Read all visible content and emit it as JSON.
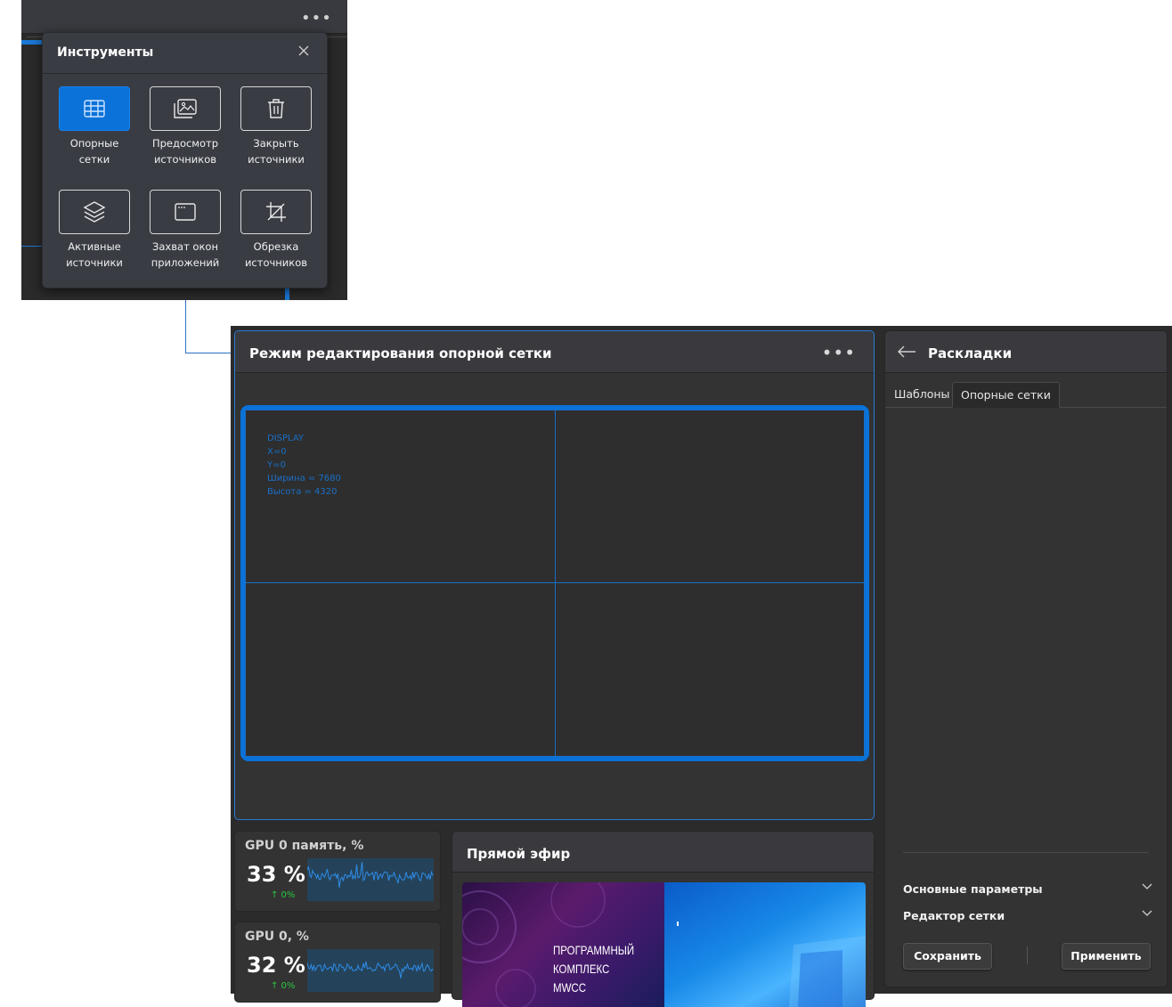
{
  "tools": {
    "title": "Инструменты",
    "items": [
      {
        "line1": "Опорные",
        "line2": "сетки",
        "icon": "grid-icon",
        "active": true
      },
      {
        "line1": "Предосмотр",
        "line2": "источников",
        "icon": "gallery-icon",
        "active": false
      },
      {
        "line1": "Закрыть",
        "line2": "источники",
        "icon": "trash-icon",
        "active": false
      },
      {
        "line1": "Активные",
        "line2": "источники",
        "icon": "layers-icon",
        "active": false
      },
      {
        "line1": "Захват окон",
        "line2": "приложений",
        "icon": "window-icon",
        "active": false
      },
      {
        "line1": "Обрезка",
        "line2": "источников",
        "icon": "crop-icon",
        "active": false
      }
    ]
  },
  "editor": {
    "title": "Режим редактирования опорной сетки",
    "display": {
      "line1": "DISPLAY",
      "line2": "X=0",
      "line3": "Y=0",
      "line4": "Ширина = 7680",
      "line5": "Высота = 4320"
    }
  },
  "stats": [
    {
      "title": "GPU 0 память, %",
      "value": "33 %",
      "delta": "↑ 0%",
      "level": 0.33
    },
    {
      "title": "GPU 0, %",
      "value": "32 %",
      "delta": "↑ 0%",
      "level": 0.32
    }
  ],
  "live": {
    "title": "Прямой эфир",
    "text_line1": "ПРОГРАММНЫЙ",
    "text_line2": "КОМПЛЕКС MWCC"
  },
  "panel": {
    "title": "Раскладки",
    "tabs": [
      "Шаблоны",
      "Опорные сетки"
    ],
    "active_tab": "Опорные сетки",
    "accordion": [
      "Основные параметры",
      "Редактор сетки"
    ],
    "save_label": "Сохранить",
    "apply_label": "Применить"
  },
  "colors": {
    "accent": "#0a72d8",
    "positive": "#28c840",
    "panel_bg": "#333333"
  }
}
